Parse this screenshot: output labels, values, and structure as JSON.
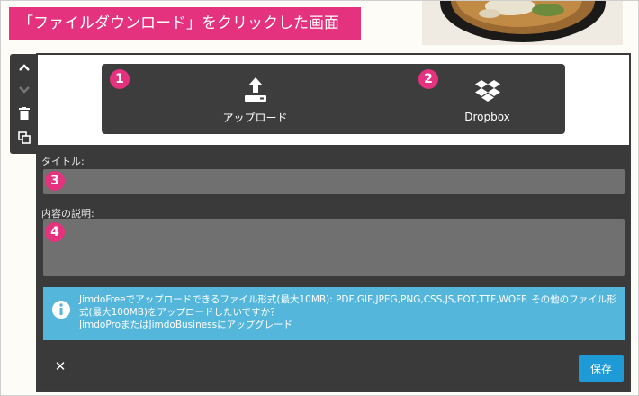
{
  "caption": "「ファイルダウンロード」をクリックした画面",
  "upload": {
    "upload_label": "アップロード",
    "dropbox_label": "Dropbox"
  },
  "badges": [
    "1",
    "2",
    "3",
    "4"
  ],
  "fields": {
    "title_label": "タイトル:",
    "title_value": "",
    "description_label": "内容の説明:",
    "description_value": ""
  },
  "info": {
    "line1": "JimdoFreeでアップロードできるファイル形式(最大10MB): PDF,GIF,JPEG,PNG,CSS,JS,EOT,TTF,WOFF. その他のファイル形式(最大100MB)をアップロードしたいですか？",
    "link": "JimdoProまたはJimdoBusinessにアップグレード"
  },
  "footer": {
    "close_symbol": "✕",
    "save_label": "保存"
  },
  "colors": {
    "accent_pink": "#e4327e",
    "info_blue": "#55b6dc",
    "save_blue": "#1e9ad6",
    "panel_dark": "#3a3a3a"
  },
  "icons": [
    "chevron-up-icon",
    "chevron-down-icon",
    "trash-icon",
    "duplicate-icon",
    "upload-icon",
    "dropbox-icon",
    "info-icon",
    "close-icon"
  ]
}
